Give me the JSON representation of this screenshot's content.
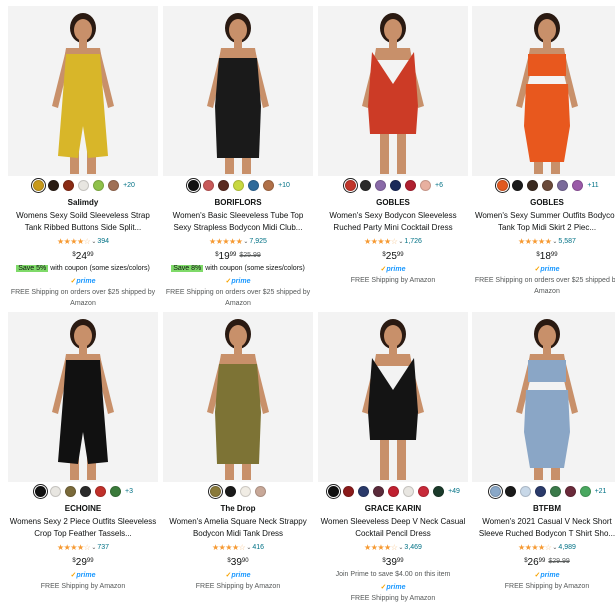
{
  "products": [
    {
      "brand": "Salimdy",
      "title": "Womens Sexy Soild Sleeveless Strap Tank Ribbed Buttons Side Split...",
      "rating": 4.0,
      "rating_count": "394",
      "price_whole": "24",
      "price_frac": "99",
      "currency": "$",
      "price_was": "",
      "coupon_badge": "Save 5%",
      "coupon_text": "with coupon (some sizes/colors)",
      "prime": "prime",
      "shipping": "FREE Shipping on orders over $25 shipped by Amazon",
      "more_colors": "+20",
      "swatches": [
        "#c89a1a",
        "#2b1d14",
        "#8a2b14",
        "#e8e6e1",
        "#8fc14a",
        "#a07055"
      ],
      "dress_color": "#d8b629"
    },
    {
      "brand": "BORIFLORS",
      "title": "Women's Basic Sleeveless Tube Top Sexy Strapless Bodycon Midi Club...",
      "rating": 4.5,
      "rating_count": "7,925",
      "price_whole": "19",
      "price_frac": "99",
      "currency": "$",
      "price_was": "$25.99",
      "coupon_badge": "Save 8%",
      "coupon_text": "with coupon (some sizes/colors)",
      "prime": "prime",
      "shipping": "FREE Shipping on orders over $25 shipped by Amazon",
      "more_colors": "+10",
      "swatches": [
        "#111111",
        "#c85a5a",
        "#5a2a20",
        "#c8d840",
        "#2e6a9a",
        "#b07048"
      ],
      "dress_color": "#1a1a1a"
    },
    {
      "brand": "GOBLES",
      "title": "Women's Sexy Bodycon Sleeveless Ruched Party Mini Cocktail Dress",
      "rating": 4.0,
      "rating_count": "1,726",
      "price_whole": "25",
      "price_frac": "99",
      "currency": "$",
      "price_was": "",
      "coupon_badge": "",
      "coupon_text": "",
      "prime": "prime",
      "shipping": "FREE Shipping by Amazon",
      "more_colors": "+6",
      "swatches": [
        "#c0352a",
        "#2a2a2a",
        "#8a6aa8",
        "#1a2a5a",
        "#b02030",
        "#e8b0a0"
      ],
      "dress_color": "#cc3b26"
    },
    {
      "brand": "GOBLES",
      "title": "Women's Sexy Summer Outfits Bodycon Tank Top Midi Skirt 2 Piec...",
      "rating": 4.5,
      "rating_count": "5,587",
      "price_whole": "18",
      "price_frac": "99",
      "currency": "$",
      "price_was": "",
      "coupon_badge": "",
      "coupon_text": "",
      "prime": "prime",
      "shipping": "FREE Shipping on orders over $25 shipped by Amazon",
      "more_colors": "+11",
      "swatches": [
        "#e25a20",
        "#1a1a1a",
        "#3a2a20",
        "#6a4a3a",
        "#7a6a9a",
        "#9a5aa8"
      ],
      "dress_color": "#e8581e"
    },
    {
      "brand": "ECHOINE",
      "title": "Womens Sexy 2 Piece Outfits Sleeveless Crop Top Feather Tassels...",
      "rating": 3.5,
      "rating_count": "737",
      "price_whole": "29",
      "price_frac": "99",
      "currency": "$",
      "price_was": "",
      "coupon_badge": "",
      "coupon_text": "",
      "prime": "prime",
      "shipping": "FREE Shipping by Amazon",
      "more_colors": "+3",
      "swatches": [
        "#111111",
        "#e8e6e1",
        "#7a6a3a",
        "#2a2a2a",
        "#c0302a",
        "#3a7a3a"
      ],
      "dress_color": "#111111"
    },
    {
      "brand": "The Drop",
      "title": "Women's Amelia Square Neck Strappy Bodycon Midi Tank Dress",
      "rating": 4.0,
      "rating_count": "416",
      "price_whole": "39",
      "price_frac": "90",
      "currency": "$",
      "price_was": "",
      "coupon_badge": "",
      "coupon_text": "",
      "prime": "prime",
      "shipping": "FREE Shipping by Amazon",
      "more_colors": "",
      "swatches": [
        "#8a7a3a",
        "#1a1a1a",
        "#f0ece4",
        "#c8a898"
      ],
      "dress_color": "#7d7335"
    },
    {
      "brand": "GRACE KARIN",
      "title": "Women Sleeveless Deep V Neck Casual Cocktail Pencil Dress",
      "rating": 4.0,
      "rating_count": "3,469",
      "price_whole": "39",
      "price_frac": "99",
      "currency": "$",
      "price_was": "",
      "coupon_badge": "",
      "coupon_text": "",
      "prime_offer": "Join Prime to save $4.00 on this item",
      "prime": "prime",
      "shipping": "FREE Shipping by Amazon",
      "more_colors": "+49",
      "swatches": [
        "#111111",
        "#8a1a1a",
        "#2a3a6a",
        "#5a2a3a",
        "#c02030",
        "#e8e6e1",
        "#c82a3a",
        "#1a3a2a"
      ],
      "dress_color": "#141414"
    },
    {
      "brand": "BTFBM",
      "title": "Women's 2021 Casual V Neck Short Sleeve Ruched Bodycon T Shirt Sho...",
      "rating": 4.0,
      "rating_count": "4,989",
      "price_whole": "26",
      "price_frac": "99",
      "currency": "$",
      "price_was": "$29.99",
      "coupon_badge": "",
      "coupon_text": "",
      "prime": "prime",
      "shipping": "FREE Shipping by Amazon",
      "more_colors": "+21",
      "swatches": [
        "#8aa8c8",
        "#1a1a1a",
        "#c8d8e8",
        "#2a3a6a",
        "#3a7a4a",
        "#6a2a3a",
        "#4aa860"
      ],
      "dress_color": "#8aa6c6"
    }
  ]
}
